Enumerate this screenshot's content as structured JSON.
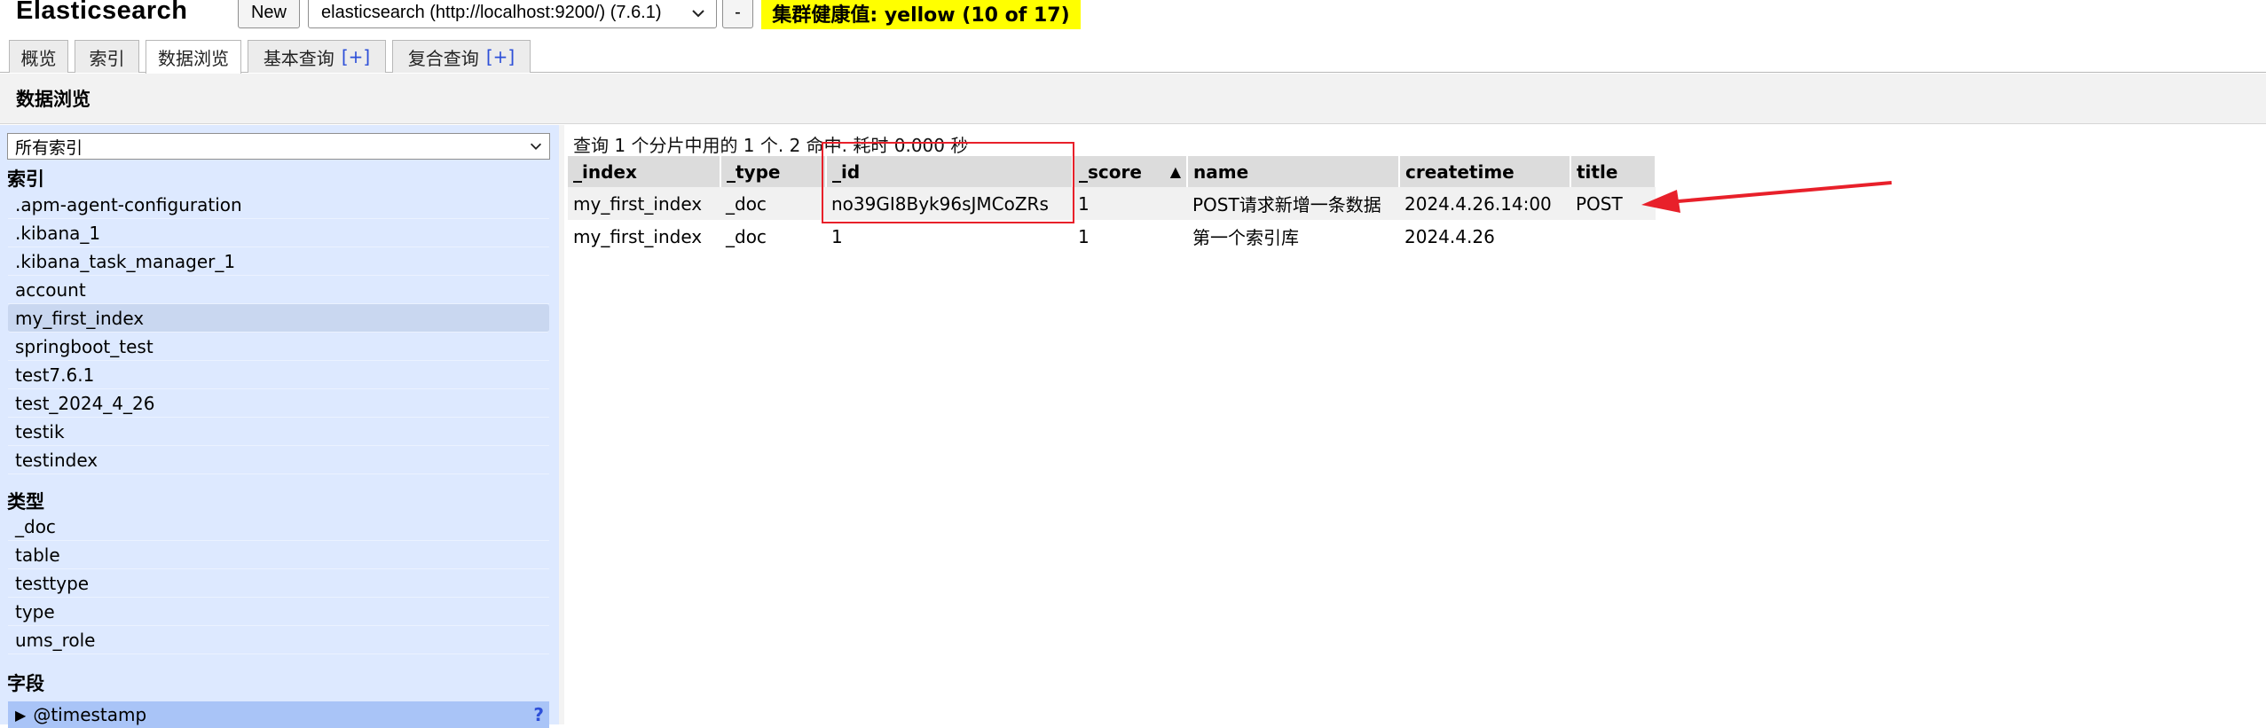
{
  "header": {
    "app_title": "Elasticsearch",
    "new_label": "New",
    "cluster_url": "elasticsearch (http://localhost:9200/) (7.6.1)",
    "minus_label": "-",
    "health_text": "集群健康值: yellow (10 of 17)",
    "health_color": "#ffff00"
  },
  "tabs": [
    {
      "label": "概览"
    },
    {
      "label": "索引"
    },
    {
      "label": "数据浏览"
    },
    {
      "label": "基本查询",
      "plus": "[+]"
    },
    {
      "label": "复合查询",
      "plus": "[+]"
    }
  ],
  "page": {
    "title": "数据浏览"
  },
  "sidebar": {
    "index_select": "所有索引",
    "index_head": "索引",
    "indices": [
      ".apm-agent-configuration",
      ".kibana_1",
      ".kibana_task_manager_1",
      "account",
      "my_first_index",
      "springboot_test",
      "test7.6.1",
      "test_2024_4_26",
      "testik",
      "testindex"
    ],
    "type_head": "类型",
    "types": [
      "_doc",
      "table",
      "testtype",
      "type",
      "ums_role"
    ],
    "field_head": "字段",
    "field_item": "@timestamp",
    "field_help": "?"
  },
  "results": {
    "summary": "查询 1 个分片中用的 1 个. 2 命中. 耗时 0.000 秒",
    "columns": [
      "_index",
      "_type",
      "_id",
      "_score",
      "name",
      "createtime",
      "title"
    ],
    "sort_indicator": "▲",
    "rows": [
      [
        "my_first_index",
        "_doc",
        "no39GI8Byk96sJMCoZRs",
        "1",
        "POST请求新增一条数据",
        "2024.4.26.14:00",
        "POST"
      ],
      [
        "my_first_index",
        "_doc",
        "1",
        "1",
        "第一个索引库",
        "2024.4.26",
        ""
      ]
    ]
  },
  "annotation_color": "#e8202a"
}
